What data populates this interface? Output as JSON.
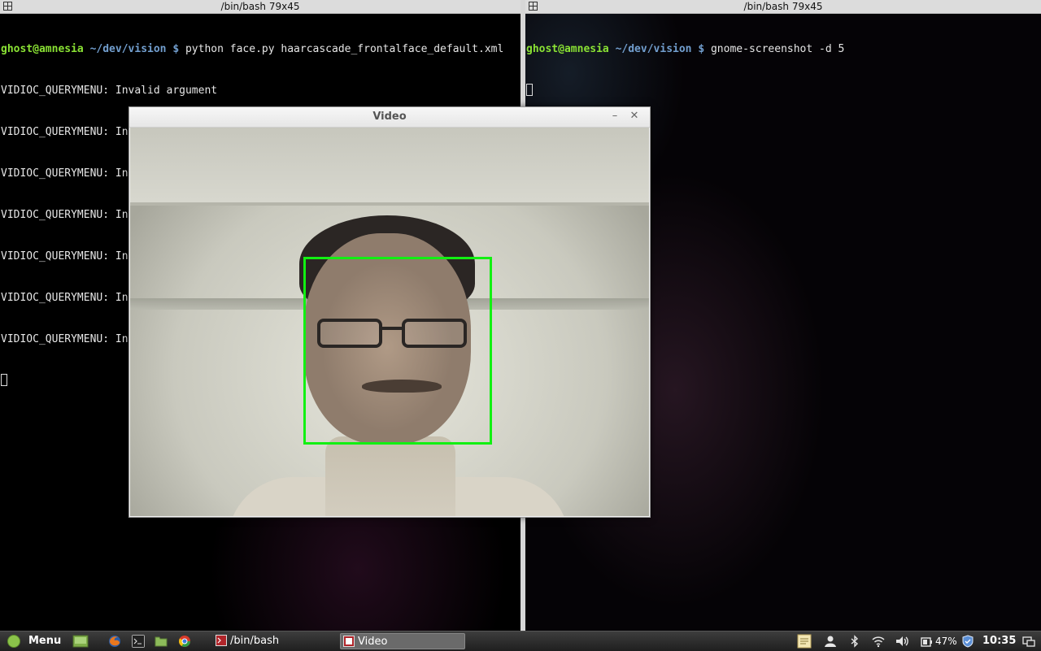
{
  "terminal_left": {
    "title": "/bin/bash 79x45",
    "prompt_user": "ghost@amnesia",
    "prompt_path": " ~/dev/vision $ ",
    "command": "python face.py haarcascade_frontalface_default.xml",
    "output_lines": [
      "VIDIOC_QUERYMENU: Invalid argument",
      "VIDIOC_QUERYMENU: Invalid argument",
      "VIDIOC_QUERYMENU: Invalid argument",
      "VIDIOC_QUERYMENU: Invalid argument",
      "VIDIOC_QUERYMENU: Invalid argument",
      "VIDIOC_QUERYMENU: Invalid argument",
      "VIDIOC_QUERYMENU: Invalid argument"
    ]
  },
  "terminal_right": {
    "title": "/bin/bash 79x45",
    "prompt_user": "ghost@amnesia",
    "prompt_path": " ~/dev/vision $ ",
    "command": "gnome-screenshot -d 5"
  },
  "video_window": {
    "title": "Video",
    "minimize_glyph": "–",
    "close_glyph": "✕"
  },
  "taskbar": {
    "menu_label": "Menu",
    "tasks": [
      {
        "label": "/bin/bash"
      },
      {
        "label": "Video"
      }
    ],
    "battery": "47%",
    "clock": "10:35"
  },
  "colors": {
    "face_box": "#12f012",
    "prompt_user": "#8ae234",
    "prompt_path": "#729fcf"
  }
}
